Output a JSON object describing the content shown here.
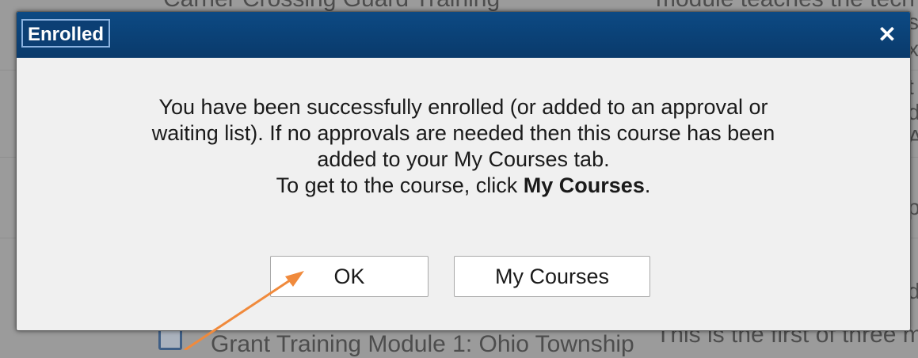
{
  "background": {
    "top_text": "Carrier Crossing Guard Training",
    "top_right_text": "module teaches the tech",
    "bottom_text": "Grant Training Module 1: Ohio Township",
    "bottom_right_text": "This is the first of three m",
    "right_fragments": [
      "si",
      "x",
      "t",
      "d",
      "A",
      "p",
      "d"
    ]
  },
  "dialog": {
    "title": "Enrolled",
    "close_icon": "close-icon",
    "message": {
      "line1": "You have been successfully enrolled (or added to an approval or",
      "line2": "waiting list). If no approvals are needed then this course has been",
      "line3": "added to your My Courses tab.",
      "line4_prefix": "To get to the course, click ",
      "line4_bold": "My Courses",
      "line4_suffix": "."
    },
    "buttons": {
      "ok": "OK",
      "my_courses": "My Courses"
    }
  },
  "colors": {
    "titlebar": "#0a3f75",
    "annotation_arrow": "#f08a3c"
  }
}
